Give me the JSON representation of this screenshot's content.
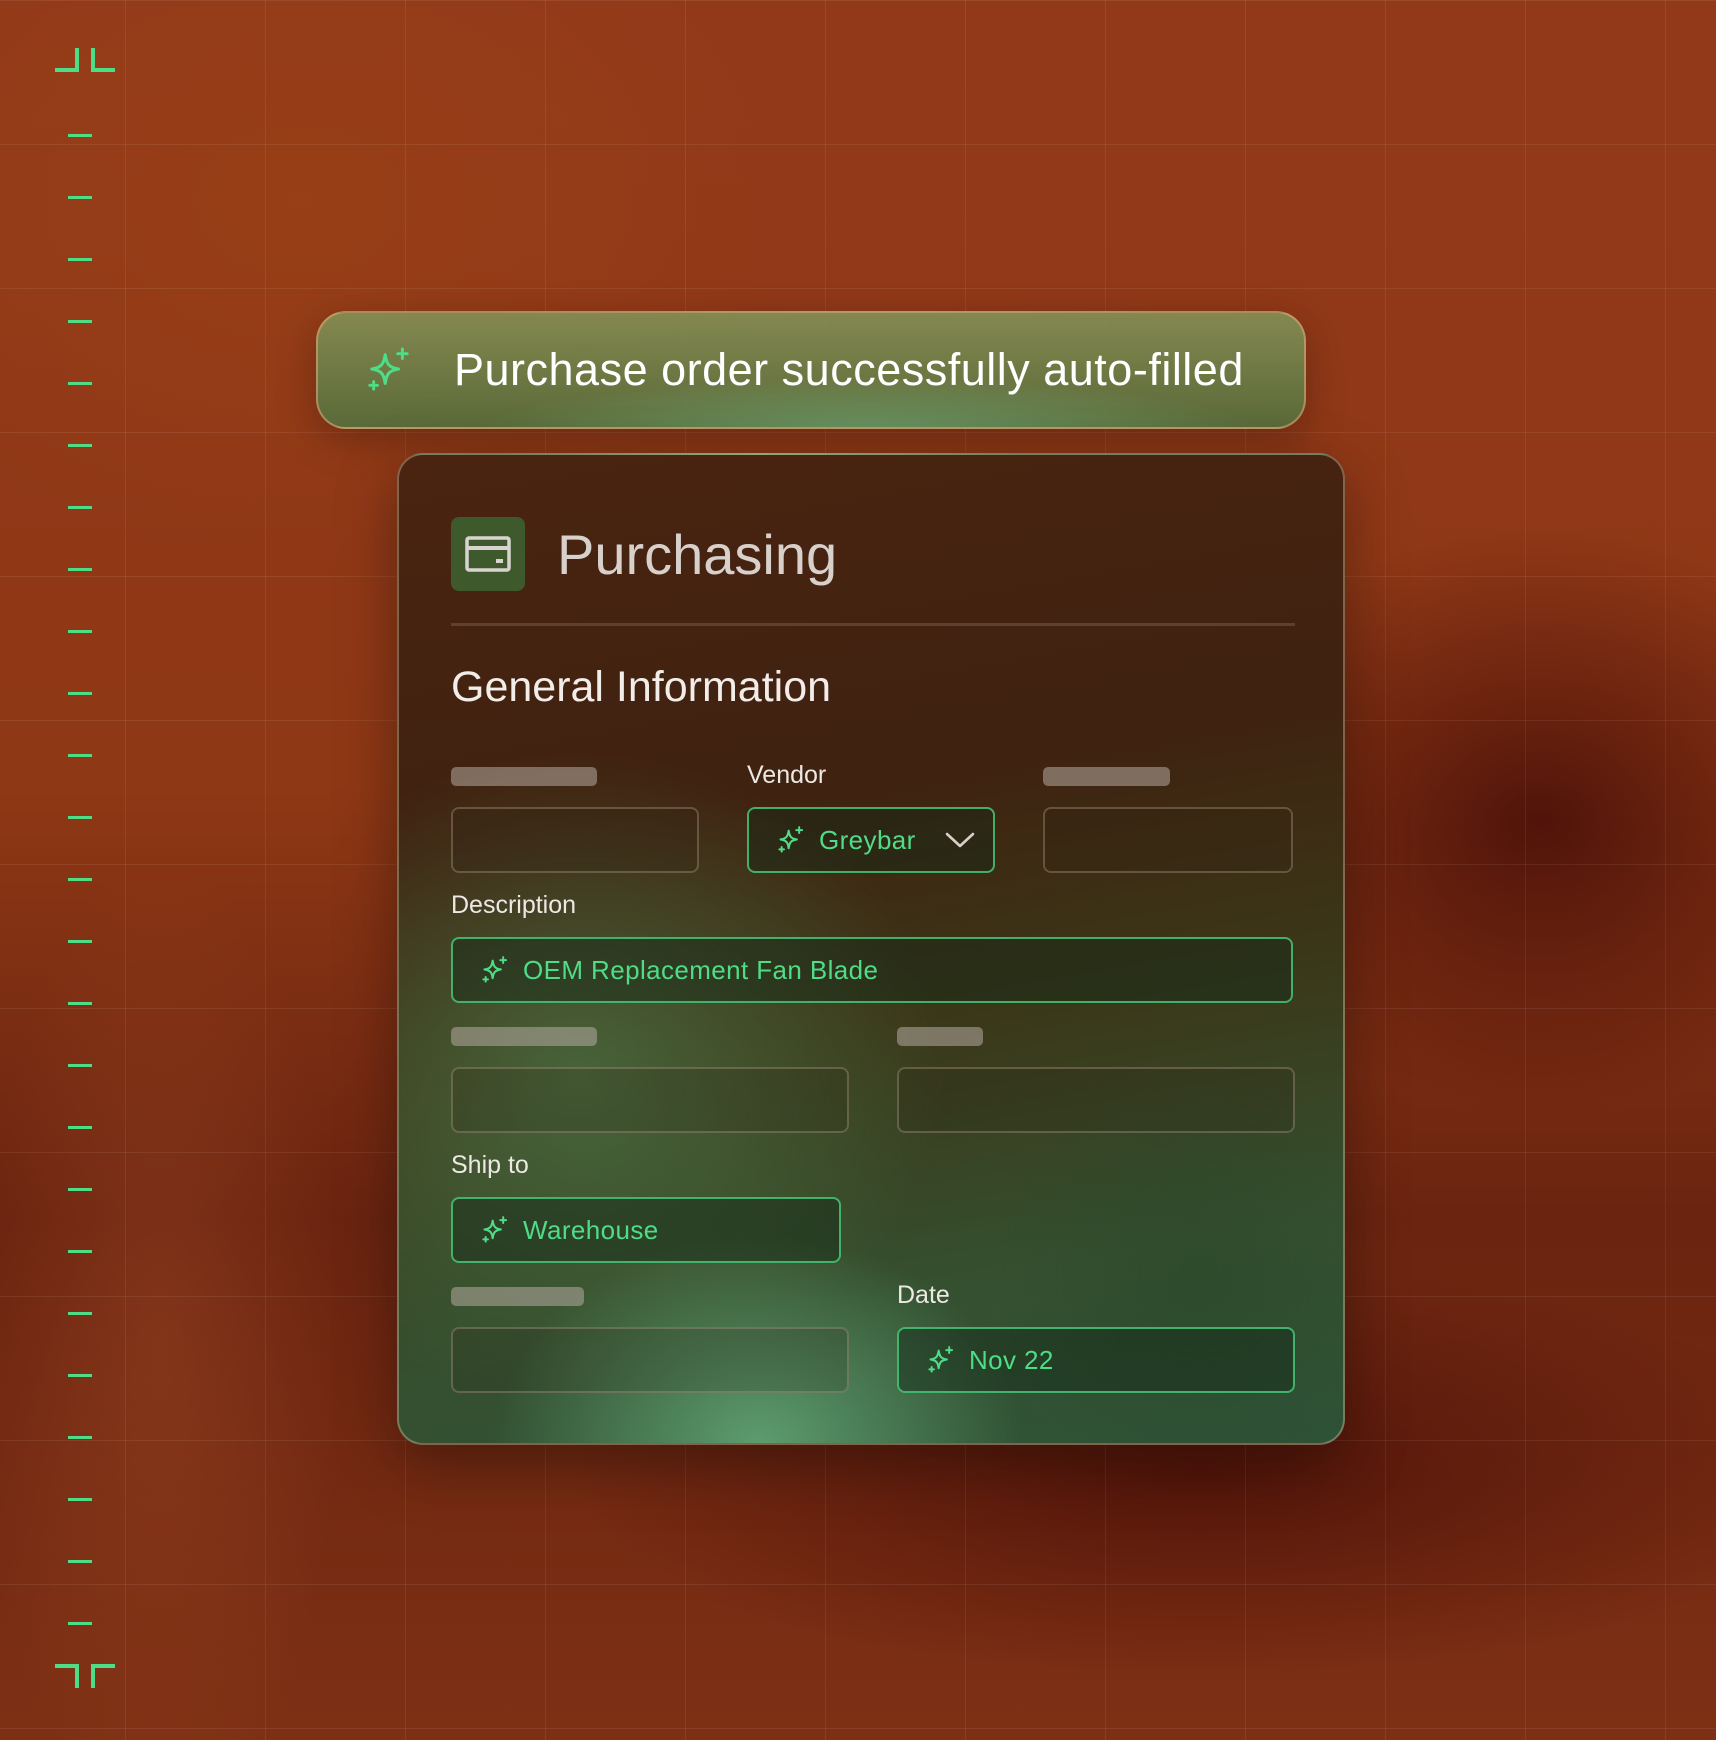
{
  "toast": {
    "message": "Purchase order successfully auto-filled",
    "icon": "sparkle-icon"
  },
  "card": {
    "title": "Purchasing",
    "icon": "credit-card-icon",
    "section_title": "General Information",
    "fields": {
      "vendor": {
        "label": "Vendor",
        "value": "Greybar",
        "icon": "sparkle-icon",
        "control": "dropdown"
      },
      "description": {
        "label": "Description",
        "value": "OEM Replacement Fan Blade",
        "icon": "sparkle-icon"
      },
      "ship_to": {
        "label": "Ship to",
        "value": "Warehouse",
        "icon": "sparkle-icon"
      },
      "date": {
        "label": "Date",
        "value": "Nov 22",
        "icon": "sparkle-icon"
      }
    }
  },
  "colors": {
    "accent": "#4fdc87",
    "background": "#8e3a12"
  }
}
